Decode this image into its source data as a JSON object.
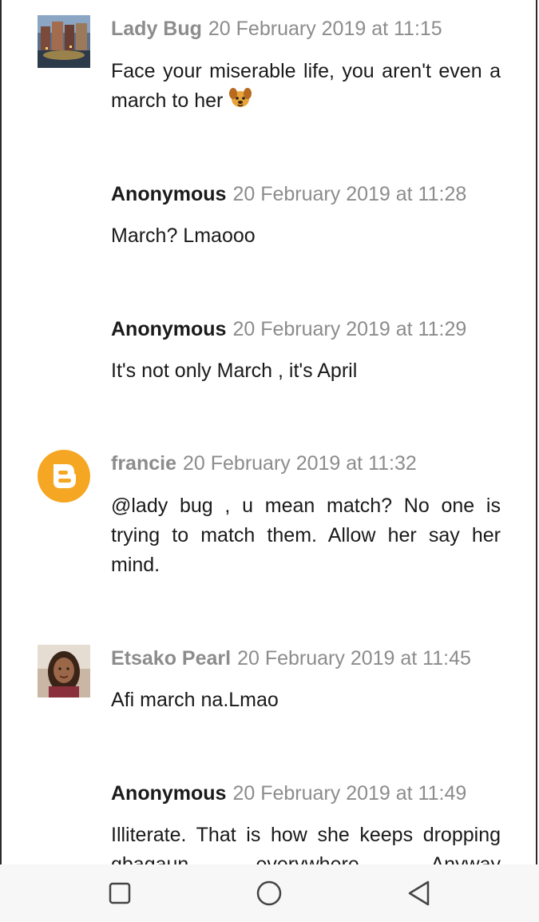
{
  "comments": [
    {
      "author": "Lady Bug",
      "timestamp": "20 February 2019 at 11:15",
      "text": "Face your miserable life, you aren't even a march to her",
      "emoji": "dog-face-emoji"
    },
    {
      "author": "Anonymous",
      "timestamp": "20 February 2019 at 11:28",
      "text": "March? Lmaooo"
    },
    {
      "author": "Anonymous",
      "timestamp": "20 February 2019 at 11:29",
      "text": "It's not only March , it's April"
    },
    {
      "author": "francie",
      "timestamp": "20 February 2019 at 11:32",
      "text": "@lady bug , u mean match? No one is trying to match them. Allow her say her mind."
    },
    {
      "author": "Etsako Pearl",
      "timestamp": "20 February 2019 at 11:45",
      "text": "Afi march na.Lmao"
    },
    {
      "author": "Anonymous",
      "timestamp": "20 February 2019 at 11:49",
      "text": "Illiterate. That is how she keeps dropping gbagaun everywhere. Anyway"
    }
  ],
  "colors": {
    "link_author": "#8c8c8c",
    "timestamp": "#8c8c8c",
    "blogger_orange": "#f5a623"
  },
  "navbar": {
    "icons": [
      "recents-square-icon",
      "home-circle-icon",
      "back-triangle-icon"
    ]
  }
}
